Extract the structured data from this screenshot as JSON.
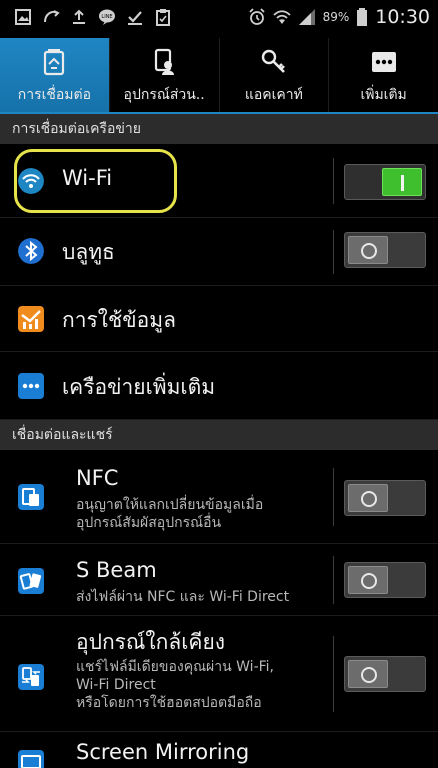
{
  "status_bar": {
    "battery_percent": "89%",
    "time": "10:30",
    "icons_left": [
      "gallery-icon",
      "sync-icon",
      "upload-icon",
      "line-icon",
      "download-done-icon",
      "clipboard-icon"
    ],
    "icons_right": [
      "alarm-icon",
      "wifi-signal-icon",
      "cell-signal-icon",
      "battery-icon"
    ]
  },
  "tabs": [
    {
      "label": "การเชื่อมต่อ",
      "icon": "connections-icon",
      "active": true
    },
    {
      "label": "อุปกรณ์ส่วน..",
      "icon": "my-device-icon",
      "active": false
    },
    {
      "label": "แอคเคาท์",
      "icon": "accounts-key-icon",
      "active": false
    },
    {
      "label": "เพิ่มเติม",
      "icon": "more-icon",
      "active": false
    }
  ],
  "sections": {
    "network": {
      "header": "การเชื่อมต่อเครือข่าย"
    },
    "connect_share": {
      "header": "เชื่อมต่อและแชร์"
    }
  },
  "rows": {
    "wifi": {
      "title": "Wi-Fi",
      "icon": "wifi-icon",
      "toggle": "on"
    },
    "bluetooth": {
      "title": "บลูทูธ",
      "icon": "bluetooth-icon",
      "toggle": "off"
    },
    "data_usage": {
      "title": "การใช้ข้อมูล",
      "icon": "data-usage-icon"
    },
    "more_networks": {
      "title": "เครือข่ายเพิ่มเติม",
      "icon": "more-networks-icon"
    },
    "nfc": {
      "title": "NFC",
      "desc_line1": "อนุญาตให้แลกเปลี่ยนข้อมูลเมื่อ",
      "desc_line2": "อุปกรณ์สัมผัสอุปกรณ์อื่น",
      "icon": "nfc-icon",
      "toggle": "off"
    },
    "sbeam": {
      "title": "S Beam",
      "desc_line1": "ส่งไฟล์ผ่าน NFC และ Wi-Fi Direct",
      "icon": "s-beam-icon",
      "toggle": "off"
    },
    "nearby": {
      "title": "อุปกรณ์ใกล้เคียง",
      "desc_line1": "แชร์ไฟล์มีเดียของคุณผ่าน Wi-Fi,",
      "desc_line2": "Wi-Fi Direct",
      "desc_line3": "หรือโดยการใช้ฮอตสปอตมือถือ",
      "icon": "nearby-devices-icon",
      "toggle": "off"
    },
    "screen_mirroring": {
      "title": "Screen Mirroring",
      "icon": "screen-mirroring-icon"
    }
  },
  "colors": {
    "accent": "#1f86c4",
    "toggle_on": "#3fbf2e",
    "highlight": "#e7e34a",
    "section_bg": "#2c2c2c"
  }
}
